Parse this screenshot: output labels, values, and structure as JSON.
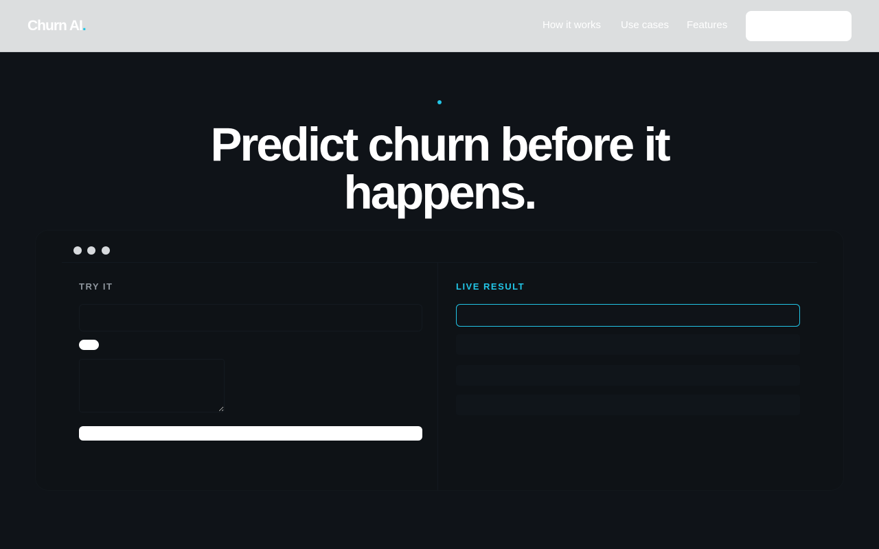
{
  "brand": {
    "name": "Churn AI",
    "dot": "."
  },
  "nav": {
    "links": [
      "How it works",
      "Use cases",
      "Features"
    ],
    "cta_label": ""
  },
  "hero": {
    "title_line1": "Predict churn before it",
    "title_line2": "happens."
  },
  "demo": {
    "left_label": "TRY IT",
    "right_label": "LIVE RESULT",
    "input_placeholder": "",
    "toggle_text": "",
    "textarea_placeholder": "",
    "run_label": ""
  },
  "colors": {
    "accent": "#22c5e6",
    "nav_bg": "#dcdedf",
    "page_bg": "#0f1318"
  }
}
